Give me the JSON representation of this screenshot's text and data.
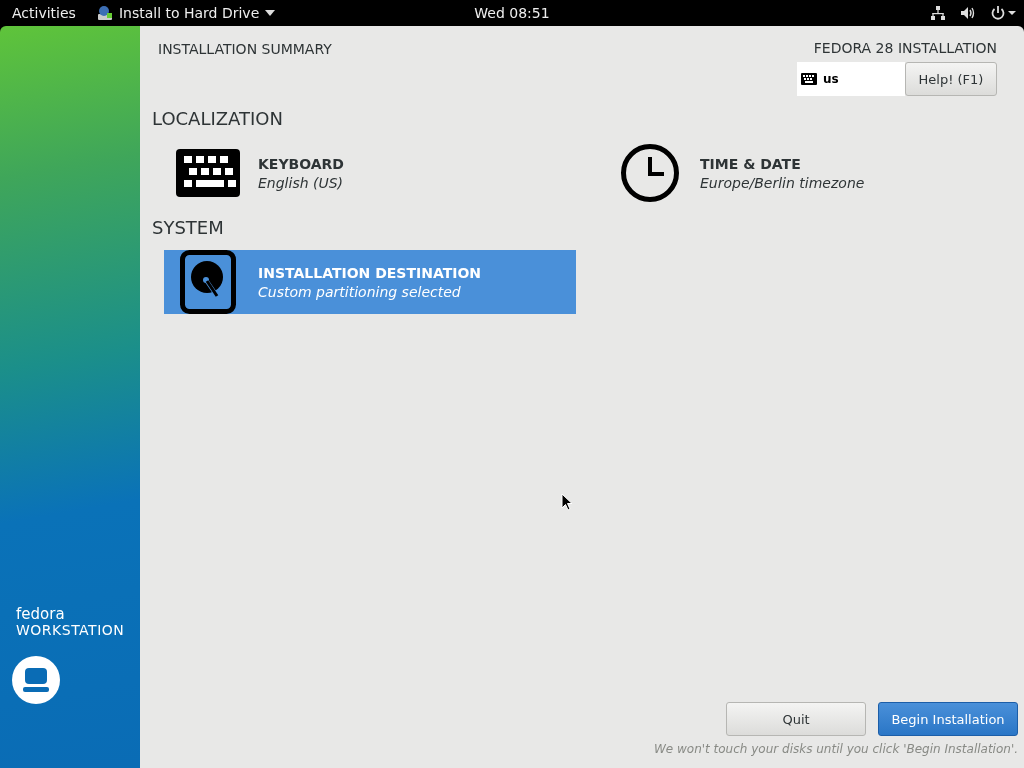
{
  "top_bar": {
    "activities": "Activities",
    "app_menu": "Install to Hard Drive",
    "clock": "Wed 08:51"
  },
  "sidebar": {
    "brand": "fedora",
    "edition": "WORKSTATION"
  },
  "header": {
    "title": "INSTALLATION SUMMARY",
    "product": "FEDORA 28 INSTALLATION",
    "keyboard_layout": "us",
    "help_button": "Help! (F1)"
  },
  "sections": [
    {
      "title": "LOCALIZATION",
      "items": [
        {
          "kind": "keyboard",
          "title": "KEYBOARD",
          "status": "English (US)",
          "selected": false
        },
        {
          "kind": "clock",
          "title": "TIME & DATE",
          "status": "Europe/Berlin timezone",
          "selected": false
        }
      ]
    },
    {
      "title": "SYSTEM",
      "items": [
        {
          "kind": "disk",
          "title": "INSTALLATION DESTINATION",
          "status": "Custom partitioning selected",
          "selected": true
        }
      ]
    }
  ],
  "buttons": [
    {
      "label": "Quit",
      "kind": "secondary"
    },
    {
      "label": "Begin Installation",
      "kind": "primary"
    }
  ],
  "footer_note": "We won't touch your disks until you click 'Begin Installation'."
}
